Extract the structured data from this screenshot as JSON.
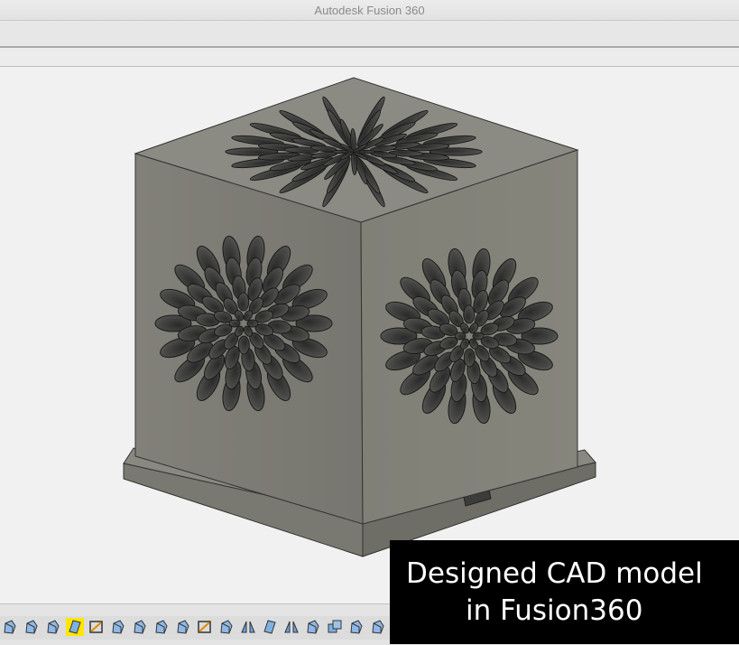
{
  "window": {
    "title": "Autodesk Fusion 360"
  },
  "viewport": {
    "model_name": "cad-box-model",
    "body_color": "#7d7c74"
  },
  "timeline": {
    "icons": [
      "extrude-feature-icon",
      "extrude-feature-icon",
      "extrude-feature-icon",
      "plane-feature-icon",
      "sketch-icon",
      "extrude-feature-icon",
      "extrude-feature-icon",
      "extrude-feature-icon",
      "extrude-feature-icon",
      "sketch-icon",
      "extrude-feature-icon",
      "mirror-feature-icon",
      "plane-feature-icon",
      "mirror-feature-icon",
      "extrude-feature-icon",
      "combine-feature-icon",
      "extrude-feature-icon",
      "extrude-feature-icon"
    ],
    "active_index": 3,
    "active_color": "#ffe600"
  },
  "caption": {
    "line1": "Designed CAD model",
    "line2": "in Fusion360"
  }
}
